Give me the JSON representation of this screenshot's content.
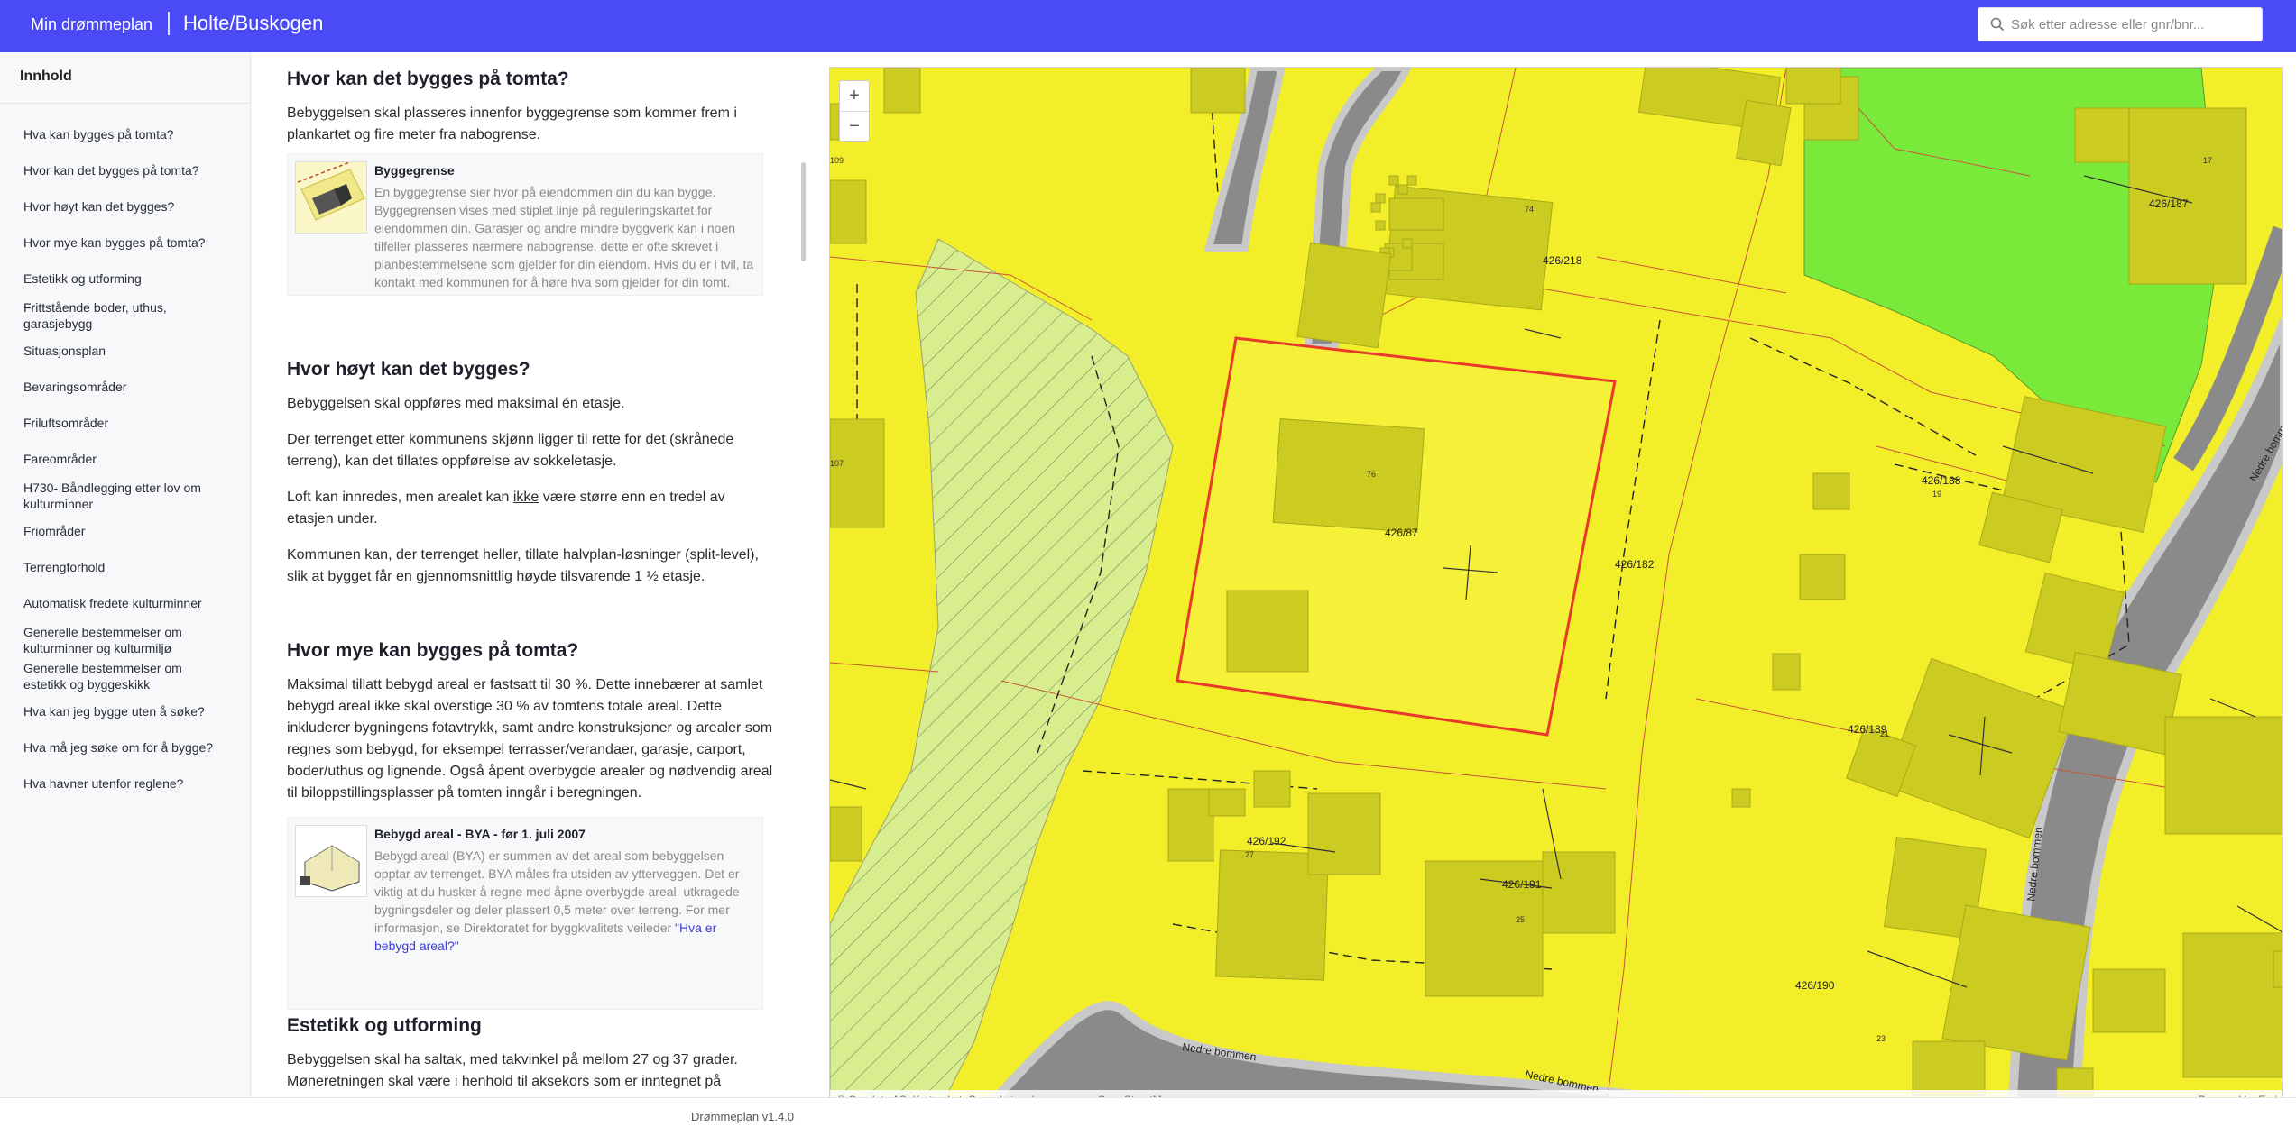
{
  "header": {
    "brand": "Min drømmeplan",
    "place": "Holte/Buskogen",
    "search_placeholder": "Søk etter adresse eller gnr/bnr..."
  },
  "sidebar": {
    "title": "Innhold",
    "items": [
      "Hva kan bygges på tomta?",
      "Hvor kan det bygges på tomta?",
      "Hvor høyt kan det bygges?",
      "Hvor mye kan bygges på tomta?",
      "Estetikk og utforming",
      "Frittstående boder, uthus, garasjebygg",
      "Situasjonsplan",
      "Bevaringsområder",
      "Friluftsområder",
      "Fareområder",
      "H730- Båndlegging etter lov om kulturminner",
      "Friområder",
      "Terrengforhold",
      "Automatisk fredete kulturminner",
      "Generelle bestemmelser om kulturminner og kulturmiljø",
      "Generelle bestemmelser om estetikk og byggeskikk",
      "Hva kan jeg bygge uten å søke?",
      "Hva må jeg søke om for å bygge?",
      "Hva havner utenfor reglene?"
    ]
  },
  "content": {
    "s1_title": "Hvor kan det bygges på tomta?",
    "s1_p1": "Bebyggelsen skal plasseres innenfor byggegrense som kommer frem i plankartet og fire meter fra nabogrense.",
    "card1_title": "Byggegrense",
    "card1_text": "En byggegrense sier hvor på eiendommen din du kan bygge. Byggegrensen vises med stiplet linje på reguleringskartet for eiendommen din. Garasjer og andre mindre byggverk kan i noen tilfeller plasseres nærmere nabogrense. dette er ofte skrevet i planbestemmelsene som gjelder for din eiendom. Hvis du er i tvil, ta kontakt med kommunen for å høre hva som gjelder for din tomt.",
    "s2_title": "Hvor høyt kan det bygges?",
    "s2_p1": "Bebyggelsen skal oppføres med maksimal én etasje.",
    "s2_p2": "Der terrenget etter kommunens skjønn ligger til rette for det (skrånede terreng), kan det tillates oppførelse av sokkeletasje.",
    "s2_p3_a": "Loft kan innredes, men arealet kan ",
    "s2_p3_b": "ikke",
    "s2_p3_c": " være større enn en tredel av etasjen under.",
    "s2_p4": "Kommunen kan, der terrenget heller, tillate halvplan-løsninger (split-level), slik at bygget får en gjennomsnittlig høyde tilsvarende 1 ½ etasje.",
    "s3_title": "Hvor mye kan bygges på tomta?",
    "s3_p1": "Maksimal tillatt bebygd areal er fastsatt til 30 %. Dette innebærer at samlet bebygd areal ikke skal overstige 30 % av tomtens totale areal. Dette inkluderer bygningens fotavtrykk, samt andre konstruksjoner og arealer som regnes som bebygd, for eksempel terrasser/verandaer, garasje, carport, boder/uthus og lignende. Også åpent overbygde arealer og nødvendig areal til biloppstillingsplasser på tomten inngår i beregningen.",
    "card2_title": "Bebygd areal - BYA - før 1. juli 2007",
    "card2_text": "Bebygd areal (BYA) er summen av det areal som bebyggelsen opptar av terrenget. BYA måles fra utsiden av ytterveggen. Det er viktig at du husker å regne med åpne overbygde areal. utkragede bygningsdeler og deler plassert 0,5 meter over terreng. For mer informasjon, se Direktoratet for byggkvalitets veileder ",
    "card2_link": "\"Hva er bebygd areal?\"",
    "s4_title": "Estetikk og utforming",
    "s4_p1": "Bebyggelsen skal ha saltak, med takvinkel på mellom 27 og 37 grader. Møneretningen skal være i henhold til aksekors som er inntegnet på"
  },
  "footer": {
    "version": "Drømmeplan v1.4.0"
  },
  "map": {
    "zoom_in": "+",
    "zoom_out": "−",
    "attribution_left": "Geodata AS, Kartverket, Geovekst og kommunene, OpenStreetMap",
    "attribution_right": "Powered by Esri",
    "labels": {
      "plot_426_87": "426/87",
      "plot_426_182": "426/182",
      "plot_426_218": "426/218",
      "plot_426_187": "426/187",
      "plot_426_188": "426/188",
      "plot_426_189": "426/189",
      "plot_426_192": "426/192",
      "plot_426_191": "426/191",
      "plot_426_190": "426/190",
      "road_1": "Nedre bommen",
      "road_2": "Nedre bommen",
      "road_3": "Nedre bommen",
      "road_4": "Nedre bommen",
      "num_76": "76",
      "num_74": "74",
      "num_17": "17",
      "num_19": "19",
      "num_21": "21",
      "num_27": "27",
      "num_25": "25",
      "num_23": "23",
      "num_109": "109",
      "num_107": "107"
    },
    "colors": {
      "zone_yellow": "#f3ee2a",
      "zone_green": "#7aea3a",
      "zone_hatched": "#d6ec8a",
      "road_gray": "#8a8a8a",
      "building": "#cccb22",
      "selected_outline": "#e8392a"
    }
  }
}
